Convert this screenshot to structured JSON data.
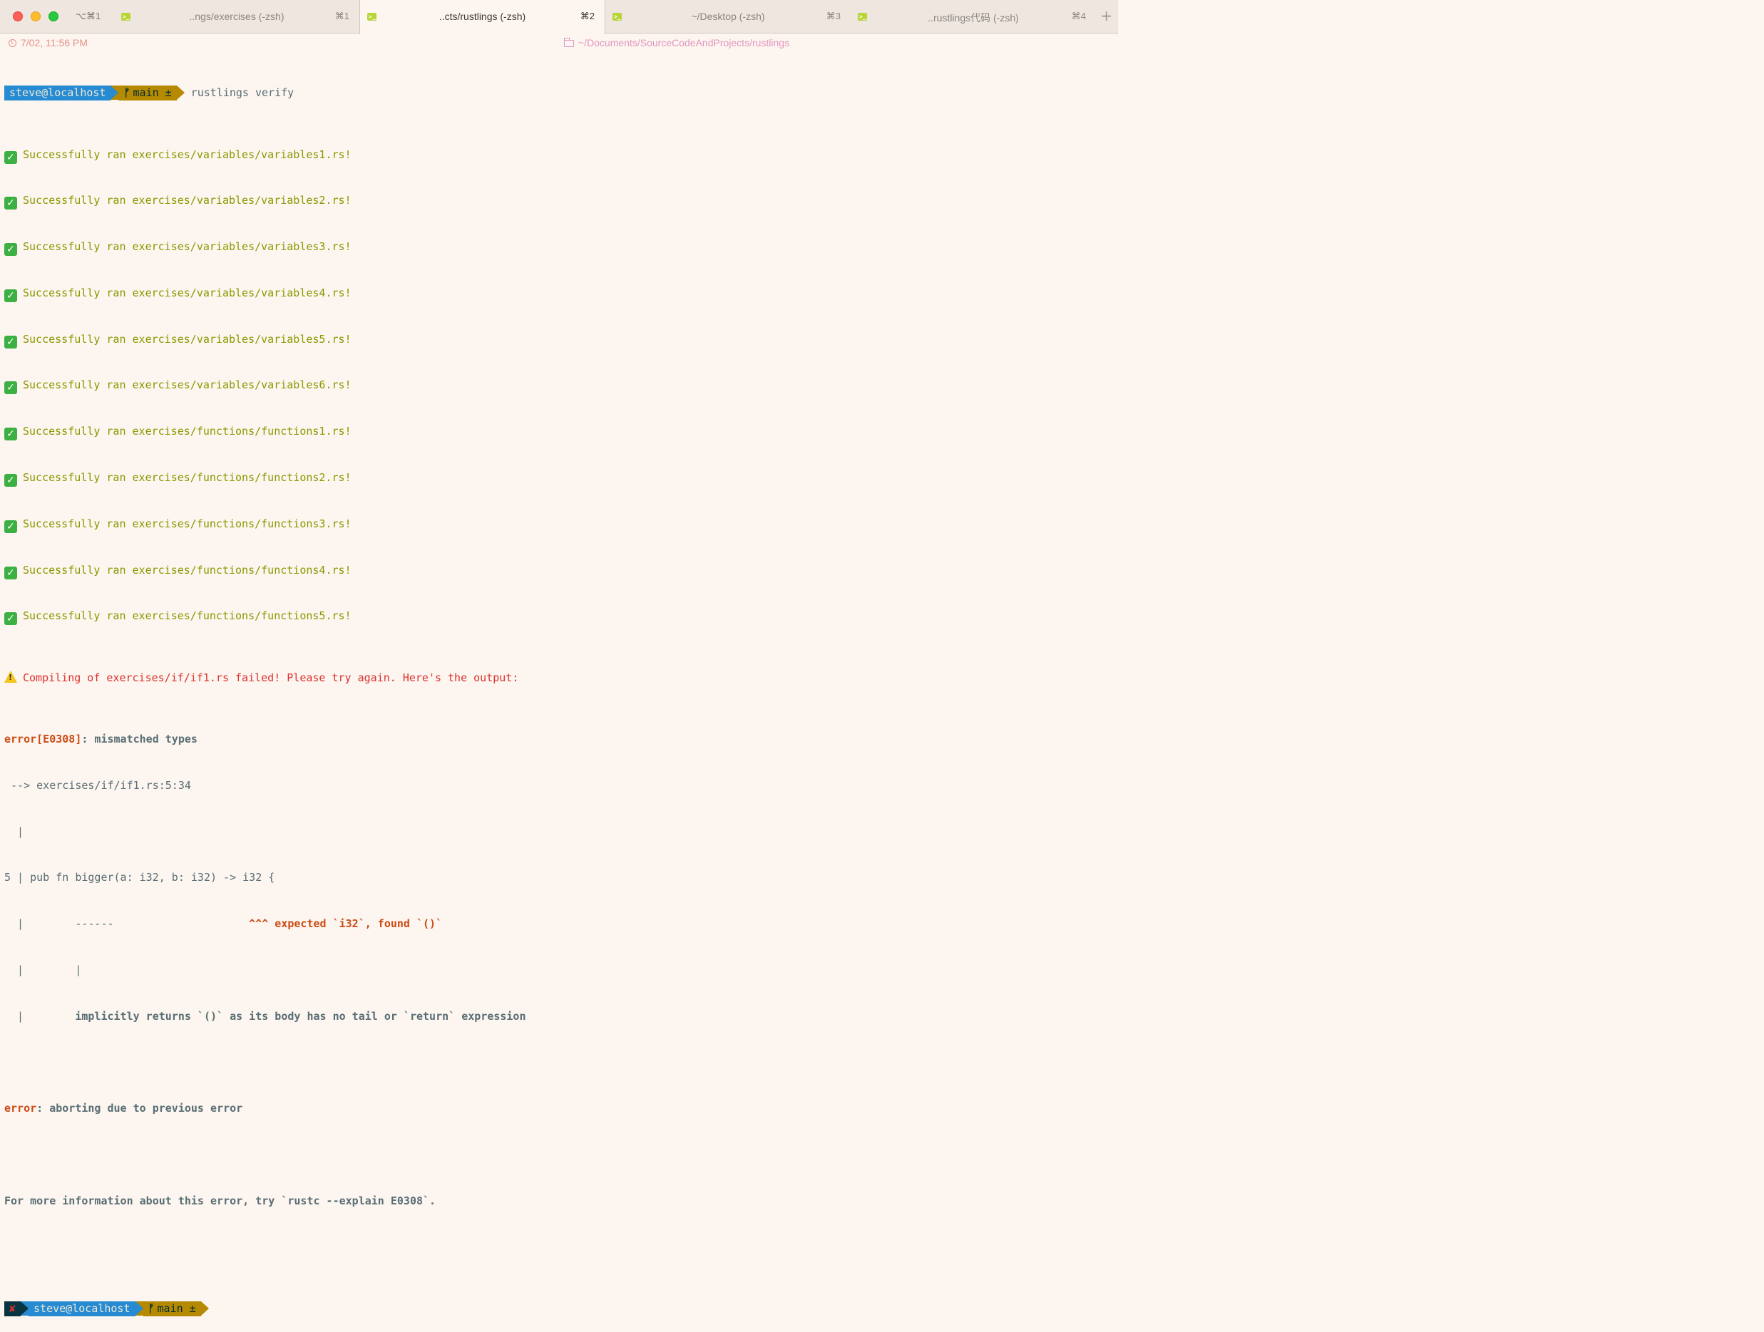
{
  "tabbar": {
    "hotkey": "⌥⌘1",
    "tabs": [
      {
        "title": "..ngs/exercises (-zsh)",
        "key": "⌘1",
        "icon": "terminal-icon"
      },
      {
        "title": "..cts/rustlings (-zsh)",
        "key": "⌘2",
        "icon": "terminal-icon",
        "active": true
      },
      {
        "title": "~/Desktop (-zsh)",
        "key": "⌘3",
        "icon": "terminal-icon"
      },
      {
        "title": "..rustlings代码 (-zsh)",
        "key": "⌘4",
        "icon": "terminal-icon"
      }
    ],
    "new_tab": "+"
  },
  "status": {
    "time": "7/02, 11:56 PM",
    "cwd": "~/Documents/SourceCodeAndProjects/rustlings"
  },
  "prompt1": {
    "user": "steve@localhost",
    "branch": "main ±",
    "command": "rustlings verify"
  },
  "successes": [
    "Successfully ran exercises/variables/variables1.rs!",
    "Successfully ran exercises/variables/variables2.rs!",
    "Successfully ran exercises/variables/variables3.rs!",
    "Successfully ran exercises/variables/variables4.rs!",
    "Successfully ran exercises/variables/variables5.rs!",
    "Successfully ran exercises/variables/variables6.rs!",
    "Successfully ran exercises/functions/functions1.rs!",
    "Successfully ran exercises/functions/functions2.rs!",
    "Successfully ran exercises/functions/functions3.rs!",
    "Successfully ran exercises/functions/functions4.rs!",
    "Successfully ran exercises/functions/functions5.rs!"
  ],
  "warning": "Compiling of exercises/if/if1.rs failed! Please try again. Here's the output:",
  "error": {
    "code": "error[E0308]",
    "message": ": mismatched types",
    "location": " --> exercises/if/if1.rs:5:34",
    "gutter_empty": "  |",
    "source_line": "5 | pub fn bigger(a: i32, b: i32) -> i32 {",
    "underline_prefix": "  |        ------                     ",
    "underline_note": "^^^ expected `i32`, found `()`",
    "pipe_line": "  |        |",
    "implicit_prefix": "  |        ",
    "implicit_note": "implicitly returns `()` as its body has no tail or `return` expression",
    "abort_label": "error",
    "abort_message": ": aborting due to previous error",
    "more_info": "For more information about this error, try `rustc --explain E0308`."
  },
  "prompt2": {
    "status": "✘",
    "user": "steve@localhost",
    "branch": "main ±"
  }
}
